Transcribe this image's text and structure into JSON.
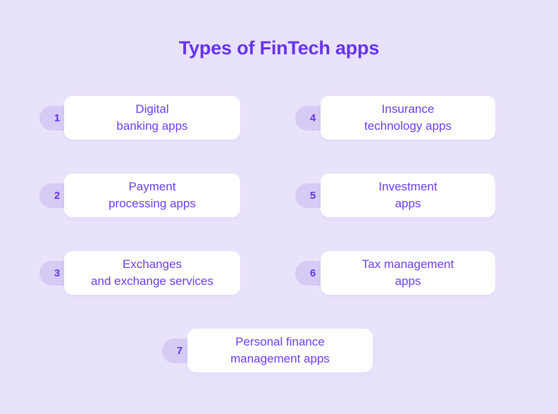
{
  "title": "Types of FinTech apps",
  "colors": {
    "background": "#e9e2fb",
    "card": "#ffffff",
    "badge": "#d5cbf5",
    "title_text": "#6633ee",
    "card_text": "#6a3cf0",
    "badge_text": "#6633ee"
  },
  "items": [
    {
      "number": "1",
      "line1": "Digital",
      "line2": "banking apps",
      "column": "left",
      "row": 1
    },
    {
      "number": "2",
      "line1": "Payment",
      "line2": "processing apps",
      "column": "left",
      "row": 2
    },
    {
      "number": "3",
      "line1": "Exchanges",
      "line2": "and exchange services",
      "column": "left",
      "row": 3
    },
    {
      "number": "4",
      "line1": "Insurance",
      "line2": "technology apps",
      "column": "right",
      "row": 1
    },
    {
      "number": "5",
      "line1": "Investment",
      "line2": "apps",
      "column": "right",
      "row": 2
    },
    {
      "number": "6",
      "line1": "Tax management",
      "line2": "apps",
      "column": "right",
      "row": 3
    },
    {
      "number": "7",
      "line1": "Personal finance",
      "line2": "management apps",
      "column": "center",
      "row": 7
    }
  ]
}
